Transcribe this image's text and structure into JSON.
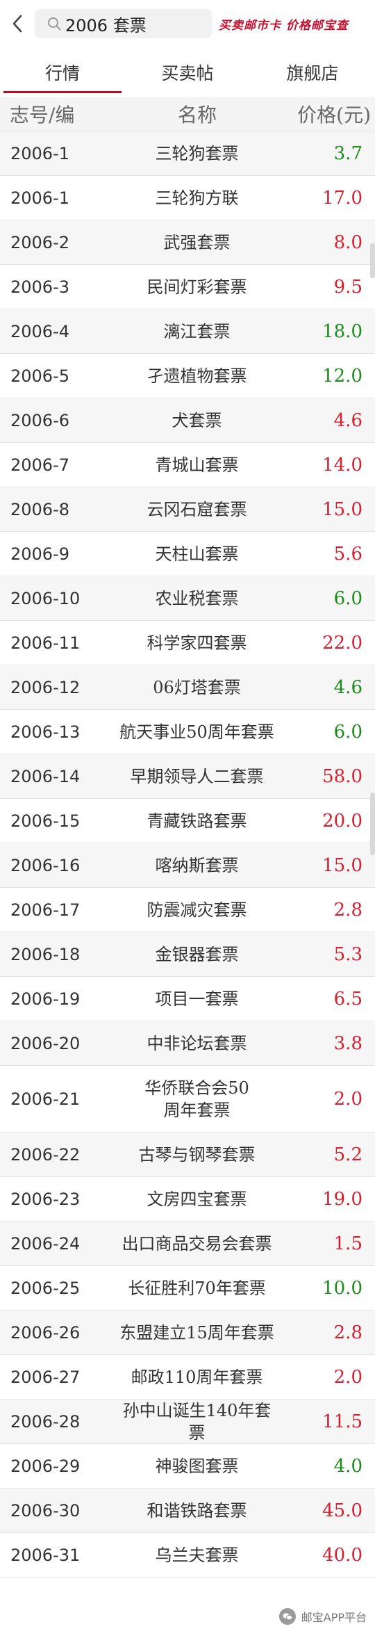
{
  "header": {
    "search_query": "2006 套票",
    "brand_text": "买卖邮市卡 价格邮宝查"
  },
  "tabs": [
    {
      "label": "行情",
      "active": true
    },
    {
      "label": "买卖帖",
      "active": false
    },
    {
      "label": "旗舰店",
      "active": false
    }
  ],
  "columns": {
    "code": "志号/编",
    "name": "名称",
    "price": "价格(元)"
  },
  "colors": {
    "up": "#d6202e",
    "down": "#1a8c1a",
    "accent": "#d0021b",
    "brand": "#c8102e"
  },
  "rows": [
    {
      "code": "2006-1",
      "name": "三轮狗套票",
      "price": "3.7",
      "trend": "down"
    },
    {
      "code": "2006-1",
      "name": "三轮狗方联",
      "price": "17.0",
      "trend": "up"
    },
    {
      "code": "2006-2",
      "name": "武强套票",
      "price": "8.0",
      "trend": "up"
    },
    {
      "code": "2006-3",
      "name": "民间灯彩套票",
      "price": "9.5",
      "trend": "up"
    },
    {
      "code": "2006-4",
      "name": "漓江套票",
      "price": "18.0",
      "trend": "down"
    },
    {
      "code": "2006-5",
      "name": "孑遗植物套票",
      "price": "12.0",
      "trend": "down"
    },
    {
      "code": "2006-6",
      "name": "犬套票",
      "price": "4.6",
      "trend": "up"
    },
    {
      "code": "2006-7",
      "name": "青城山套票",
      "price": "14.0",
      "trend": "up"
    },
    {
      "code": "2006-8",
      "name": "云冈石窟套票",
      "price": "15.0",
      "trend": "up"
    },
    {
      "code": "2006-9",
      "name": "天柱山套票",
      "price": "5.6",
      "trend": "up"
    },
    {
      "code": "2006-10",
      "name": "农业税套票",
      "price": "6.0",
      "trend": "down"
    },
    {
      "code": "2006-11",
      "name": "科学家四套票",
      "price": "22.0",
      "trend": "up"
    },
    {
      "code": "2006-12",
      "name": "06灯塔套票",
      "price": "4.6",
      "trend": "down"
    },
    {
      "code": "2006-13",
      "name": "航天事业50周年套票",
      "price": "6.0",
      "trend": "down"
    },
    {
      "code": "2006-14",
      "name": "早期领导人二套票",
      "price": "58.0",
      "trend": "up"
    },
    {
      "code": "2006-15",
      "name": "青藏铁路套票",
      "price": "20.0",
      "trend": "up"
    },
    {
      "code": "2006-16",
      "name": "喀纳斯套票",
      "price": "15.0",
      "trend": "up"
    },
    {
      "code": "2006-17",
      "name": "防震减灾套票",
      "price": "2.8",
      "trend": "up"
    },
    {
      "code": "2006-18",
      "name": "金银器套票",
      "price": "5.3",
      "trend": "up"
    },
    {
      "code": "2006-19",
      "name": "项目一套票",
      "price": "6.5",
      "trend": "up"
    },
    {
      "code": "2006-20",
      "name": "中非论坛套票",
      "price": "3.8",
      "trend": "up"
    },
    {
      "code": "2006-21",
      "name": "华侨联合会50周年套票",
      "price": "2.0",
      "trend": "up",
      "tall": true
    },
    {
      "code": "2006-22",
      "name": "古琴与钢琴套票",
      "price": "5.2",
      "trend": "up"
    },
    {
      "code": "2006-23",
      "name": "文房四宝套票",
      "price": "19.0",
      "trend": "up"
    },
    {
      "code": "2006-24",
      "name": "出口商品交易会套票",
      "price": "1.5",
      "trend": "up"
    },
    {
      "code": "2006-25",
      "name": "长征胜利70年套票",
      "price": "10.0",
      "trend": "down"
    },
    {
      "code": "2006-26",
      "name": "东盟建立15周年套票",
      "price": "2.8",
      "trend": "up"
    },
    {
      "code": "2006-27",
      "name": "邮政110周年套票",
      "price": "2.0",
      "trend": "up"
    },
    {
      "code": "2006-28",
      "name": "孙中山诞生140年套票",
      "price": "11.5",
      "trend": "up"
    },
    {
      "code": "2006-29",
      "name": "神骏图套票",
      "price": "4.0",
      "trend": "down"
    },
    {
      "code": "2006-30",
      "name": "和谐铁路套票",
      "price": "45.0",
      "trend": "up"
    },
    {
      "code": "2006-31",
      "name": "乌兰夫套票",
      "price": "40.0",
      "trend": "up"
    }
  ],
  "watermark": "邮宝APP平台"
}
